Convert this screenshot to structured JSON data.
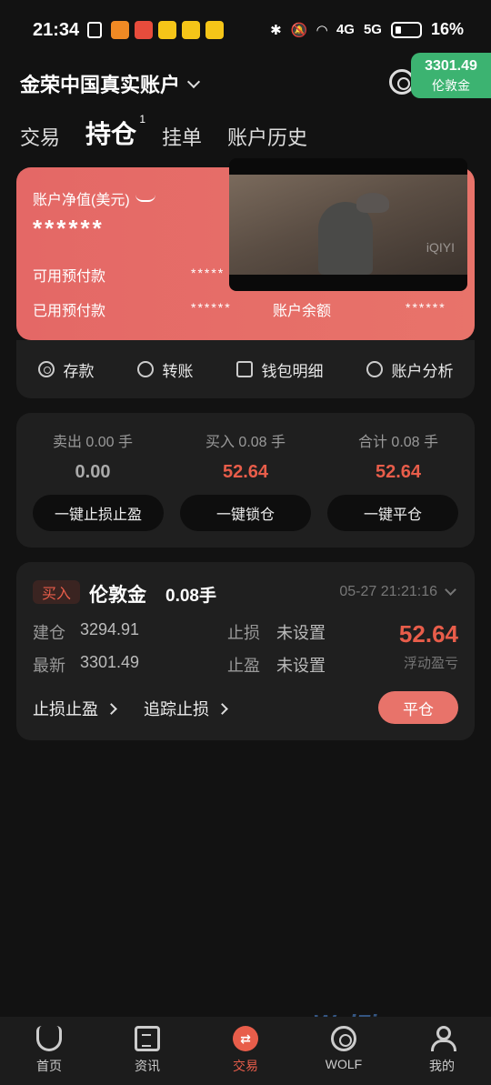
{
  "status": {
    "time": "21:34",
    "network1": "4G",
    "network2": "5G",
    "battery": "16%",
    "app_icon_colors": [
      "#f08a24",
      "#e74c3c",
      "#f5c518",
      "#f5c518",
      "#f5c518"
    ]
  },
  "header": {
    "account_name": "金荣中国真实账户",
    "price_value": "3301.49",
    "price_name": "伦敦金"
  },
  "tabs": [
    {
      "label": "交易"
    },
    {
      "label": "持仓",
      "badge": "1"
    },
    {
      "label": "挂单"
    },
    {
      "label": "账户历史"
    }
  ],
  "account_card": {
    "equity_label": "账户净值(美元)",
    "equity_value": "******",
    "available_label": "可用预付款",
    "available_value": "*****",
    "used_label": "已用预付款",
    "used_value": "******",
    "balance_label": "账户余额",
    "balance_value": "******"
  },
  "video": {
    "watermark": "iQIYI"
  },
  "actions": [
    {
      "label": "存款",
      "icon": "deposit-icon"
    },
    {
      "label": "转账",
      "icon": "transfer-icon"
    },
    {
      "label": "钱包明细",
      "icon": "wallet-icon"
    },
    {
      "label": "账户分析",
      "icon": "pie-chart-icon"
    }
  ],
  "summary": {
    "sell_label": "卖出 0.00 手",
    "sell_value": "0.00",
    "buy_label": "买入 0.08 手",
    "buy_value": "52.64",
    "total_label": "合计 0.08 手",
    "total_value": "52.64",
    "btn_sl_tp": "一键止损止盈",
    "btn_lock": "一键锁仓",
    "btn_close": "一键平仓"
  },
  "position": {
    "side": "买入",
    "symbol": "伦敦金",
    "lots": "0.08手",
    "time": "05-27 21:21:16",
    "open_label": "建仓",
    "open_value": "3294.91",
    "latest_label": "最新",
    "latest_value": "3301.49",
    "sl_label": "止损",
    "sl_value": "未设置",
    "tp_label": "止盈",
    "tp_value": "未设置",
    "profit_value": "52.64",
    "profit_label": "浮动盈亏",
    "link_sl_tp": "止损止盈",
    "link_trailing": "追踪止损",
    "close_btn": "平仓"
  },
  "nav": [
    {
      "label": "首页",
      "icon": "home-icon"
    },
    {
      "label": "资讯",
      "icon": "news-icon"
    },
    {
      "label": "交易",
      "icon": "trade-icon",
      "active": true
    },
    {
      "label": "WOLF",
      "icon": "wolf-icon"
    },
    {
      "label": "我的",
      "icon": "profile-icon"
    }
  ],
  "watermark": "WolFinance"
}
